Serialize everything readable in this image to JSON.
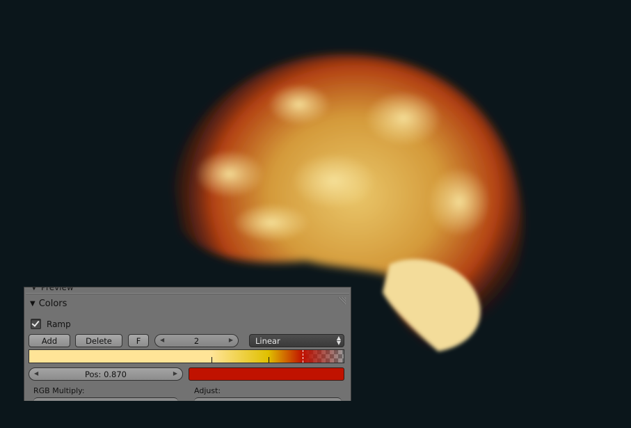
{
  "panel": {
    "cut_title": "Preview",
    "section_title": "Colors"
  },
  "ramp": {
    "enabled_label": "Ramp",
    "enabled": true,
    "add_label": "Add",
    "delete_label": "Delete",
    "flip_label": "F",
    "active_index": "2",
    "interpolation": "Linear",
    "stops": [
      {
        "pos": 0.0,
        "color": "#ffe497"
      },
      {
        "pos": 0.58,
        "color": "#ffe497"
      },
      {
        "pos": 0.76,
        "color": "#e0c000"
      },
      {
        "pos": 0.87,
        "color": "#c01000"
      },
      {
        "pos": 1.0,
        "color": "#c0100000"
      }
    ],
    "position_text": "Pos: 0.870",
    "active_color": "#c01200"
  },
  "footer": {
    "rgb_multiply_label": "RGB Multiply:",
    "adjust_label": "Adjust:"
  },
  "icons": {
    "disclosure": "triangle-down-icon",
    "grip": "panel-grip-icon",
    "check": "checkmark-icon"
  }
}
